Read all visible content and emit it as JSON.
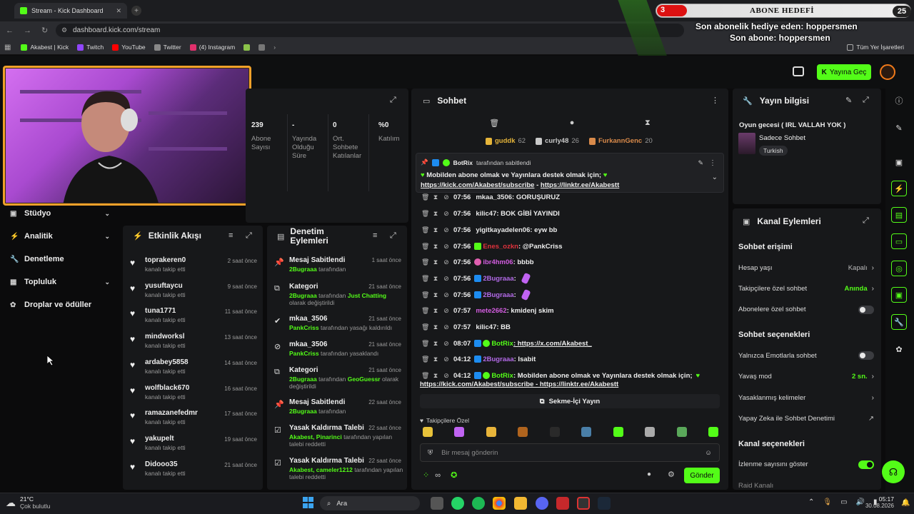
{
  "browser": {
    "tab_title": "Stream - Kick Dashboard",
    "url": "dashboard.kick.com/stream",
    "bookmarks": [
      "Akabest | Kick",
      "Twitch",
      "YouTube",
      "Twitter",
      "(4) Instagram"
    ],
    "all_bookmarks": "Tüm Yer İşaretleri"
  },
  "overlay": {
    "goal_current": "3",
    "goal_title": "ABONE HEDEFİ",
    "goal_max": "25",
    "last_gift": "Son abonelik hediye eden: hoppersmen",
    "last_sub": "Son abone: hoppersmen"
  },
  "header": {
    "go_live": "Yayına Geç"
  },
  "nav": {
    "items": [
      {
        "label": "Stüdyo",
        "icon": "studio-icon",
        "chevron": true
      },
      {
        "label": "Analitik",
        "icon": "chart-icon",
        "chevron": true
      },
      {
        "label": "Denetleme",
        "icon": "wrench-icon",
        "chevron": false
      },
      {
        "label": "Topluluk",
        "icon": "community-icon",
        "chevron": true
      },
      {
        "label": "Droplar ve ödüller",
        "icon": "gift-icon",
        "chevron": false
      }
    ]
  },
  "stats": [
    {
      "value": "239",
      "label": "Abone Sayısı"
    },
    {
      "value": "-",
      "label": "Yayında Olduğu Süre"
    },
    {
      "value": "0",
      "label": "Ort. Sohbete Katılanlar"
    },
    {
      "value": "%0",
      "label": "Katılım"
    }
  ],
  "activity": {
    "title": "Etkinlik Akışı",
    "items": [
      {
        "name": "toprakeren0",
        "sub": "kanalı takip etti",
        "time": "2 saat önce"
      },
      {
        "name": "yusuftaycu",
        "sub": "kanalı takip etti",
        "time": "9 saat önce"
      },
      {
        "name": "tuna1771",
        "sub": "kanalı takip etti",
        "time": "11 saat önce"
      },
      {
        "name": "mindworksl",
        "sub": "kanalı takip etti",
        "time": "13 saat önce"
      },
      {
        "name": "ardabey5858",
        "sub": "kanalı takip etti",
        "time": "14 saat önce"
      },
      {
        "name": "wolfblack670",
        "sub": "kanalı takip etti",
        "time": "16 saat önce"
      },
      {
        "name": "ramazanefedmr",
        "sub": "kanalı takip etti",
        "time": "17 saat önce"
      },
      {
        "name": "yakupelt",
        "sub": "kanalı takip etti",
        "time": "19 saat önce"
      },
      {
        "name": "Didooo35",
        "sub": "kanalı takip etti",
        "time": "21 saat önce"
      }
    ]
  },
  "moderation": {
    "title": "Denetim Eylemleri",
    "items": [
      {
        "icon": "pin-icon",
        "name": "Mesaj Sabitlendi",
        "green": "2Bugraaa",
        "rest": "tarafından",
        "extra": "",
        "line2": "",
        "time": "1 saat önce"
      },
      {
        "icon": "category-icon",
        "name": "Kategori",
        "green": "2Bugraaa",
        "rest": "tarafından",
        "extra": "Just Chatting",
        "line2": "olarak değiştirildi",
        "time": "21 saat önce"
      },
      {
        "icon": "unban-icon",
        "name": "mkaa_3506",
        "green": "PankCriss",
        "rest": "tarafından yasağı kaldırıldı",
        "extra": "",
        "line2": "",
        "time": "21 saat önce"
      },
      {
        "icon": "ban-icon",
        "name": "mkaa_3506",
        "green": "PankCriss",
        "rest": "tarafından yasaklandı",
        "extra": "",
        "line2": "",
        "time": "21 saat önce"
      },
      {
        "icon": "category-icon",
        "name": "Kategori",
        "green": "2Bugraaa",
        "rest": "tarafından",
        "extra": "GeoGuessr",
        "line2": "olarak değiştirildi",
        "time": "21 saat önce"
      },
      {
        "icon": "pin-icon",
        "name": "Mesaj Sabitlendi",
        "green": "2Bugraaa",
        "rest": "tarafından",
        "extra": "",
        "line2": "",
        "time": "22 saat önce"
      },
      {
        "icon": "unban-request-icon",
        "name": "Yasak Kaldırma Talebi",
        "green": "Akabest, Pinarinci",
        "rest": "tarafından yapılan",
        "extra": "",
        "line2": "talebi reddetti",
        "time": "22 saat önce"
      },
      {
        "icon": "unban-request-icon",
        "name": "Yasak Kaldırma Talebi",
        "green": "Akabest, cameler1212",
        "rest": "tarafından yapılan",
        "extra": "",
        "line2": "talebi reddetti",
        "time": "22 saat önce"
      }
    ]
  },
  "chat": {
    "title": "Sohbet",
    "leaderboard": [
      {
        "name": "guddk",
        "count": "62",
        "color": "#e6b53a"
      },
      {
        "name": "curly48",
        "count": "26",
        "color": "#c9c9c9"
      },
      {
        "name": "FurkannGenc",
        "count": "20",
        "color": "#d98a4a"
      }
    ],
    "pinned": {
      "by_user": "BotRix",
      "by_text": "tarafından sabitlendi",
      "text": "Mobilden abone olmak ve Yayınlara destek olmak için;",
      "link1": "https://kick.com/Akabest/subscribe",
      "sep": " - ",
      "link2": "https://linktr.ee/Akabestt"
    },
    "messages": [
      {
        "time": "07:56",
        "user": "mkaa_3506",
        "color": "#e8e8e8",
        "text": ": GORUŞURUZ"
      },
      {
        "time": "07:56",
        "user": "kilic47",
        "color": "#e8e8e8",
        "text": ": BOK GİBİ YAYINDI"
      },
      {
        "time": "07:56",
        "user": "yigitkayadelen06",
        "color": "#e8e8e8",
        "text": ": eyw bb"
      },
      {
        "time": "07:56",
        "user": "Enes_ozkn",
        "color": "#e0323c",
        "text": ": @PankCriss"
      },
      {
        "time": "07:56",
        "user": "ibr4hm06",
        "color": "#d35de0",
        "text": ": bbbb"
      },
      {
        "time": "07:56",
        "user": "2Bugraaa",
        "color": "#b36ae8",
        "text": ":"
      },
      {
        "time": "07:56",
        "user": "2Bugraaa",
        "color": "#b36ae8",
        "text": ":"
      },
      {
        "time": "07:57",
        "user": "mete2662",
        "color": "#d35de0",
        "text": ": kmidenj skim"
      },
      {
        "time": "07:57",
        "user": "kilic47",
        "color": "#e8e8e8",
        "text": ": BB"
      },
      {
        "time": "08:07",
        "user": "BotRix",
        "color": "#53fc18",
        "text": ": https://x.com/Akabest_"
      },
      {
        "time": "04:12",
        "user": "2Bugraaa",
        "color": "#b36ae8",
        "text": ": Isabit"
      },
      {
        "time": "04:12",
        "user": "BotRix",
        "color": "#53fc18",
        "text": ": Mobilden abone olmak ve Yayınlara destek olmak için;"
      }
    ],
    "last_line2": "https://kick.com/Akabest/subscribe - https://linktr.ee/Akabestt",
    "popout": "Sekme-İçi Yayın",
    "followers_only": "Takipçilere Özel",
    "placeholder": "Bir mesaj gönderin",
    "send": "Gönder"
  },
  "stream_info": {
    "title": "Yayın bilgisi",
    "stream_title": "Oyun gecesi ( IRL VALLAH YOK )",
    "category": "Sadece Sohbet",
    "tag": "Turkish"
  },
  "channel_actions": {
    "title": "Kanal Eylemleri",
    "sections": [
      {
        "heading": "Sohbet erişimi",
        "rows": [
          {
            "label": "Hesap yaşı",
            "value": "Kapalı",
            "type": "chev",
            "green": false
          },
          {
            "label": "Takipçilere özel sohbet",
            "value": "Anında",
            "type": "chev",
            "green": true
          },
          {
            "label": "Abonelere özel sohbet",
            "value": "",
            "type": "toggle",
            "on": false
          }
        ]
      },
      {
        "heading": "Sohbet seçenekleri",
        "rows": [
          {
            "label": "Yalnızca Emotlarla sohbet",
            "value": "",
            "type": "toggle",
            "on": false
          },
          {
            "label": "Yavaş mod",
            "value": "2 sn.",
            "type": "chev",
            "green": true
          },
          {
            "label": "Yasaklanmış kelimeler",
            "value": "",
            "type": "chev",
            "green": false
          },
          {
            "label": "Yapay Zeka ile Sohbet Denetimi",
            "value": "",
            "type": "ext",
            "green": false
          }
        ]
      },
      {
        "heading": "Kanal seçenekleri",
        "rows": [
          {
            "label": "İzlenme sayısını göster",
            "value": "",
            "type": "toggle",
            "on": true
          },
          {
            "label": "Raid Kanalı",
            "value": "",
            "type": "none",
            "green": false
          }
        ]
      }
    ]
  },
  "taskbar": {
    "weather_temp": "21°C",
    "weather_desc": "Çok bulutlu",
    "search": "Ara",
    "time": "05:17",
    "date": "30.08.2026"
  },
  "colors": {
    "accent": "#53fc18",
    "panel": "#17181a",
    "bg": "#0b0b0c"
  }
}
